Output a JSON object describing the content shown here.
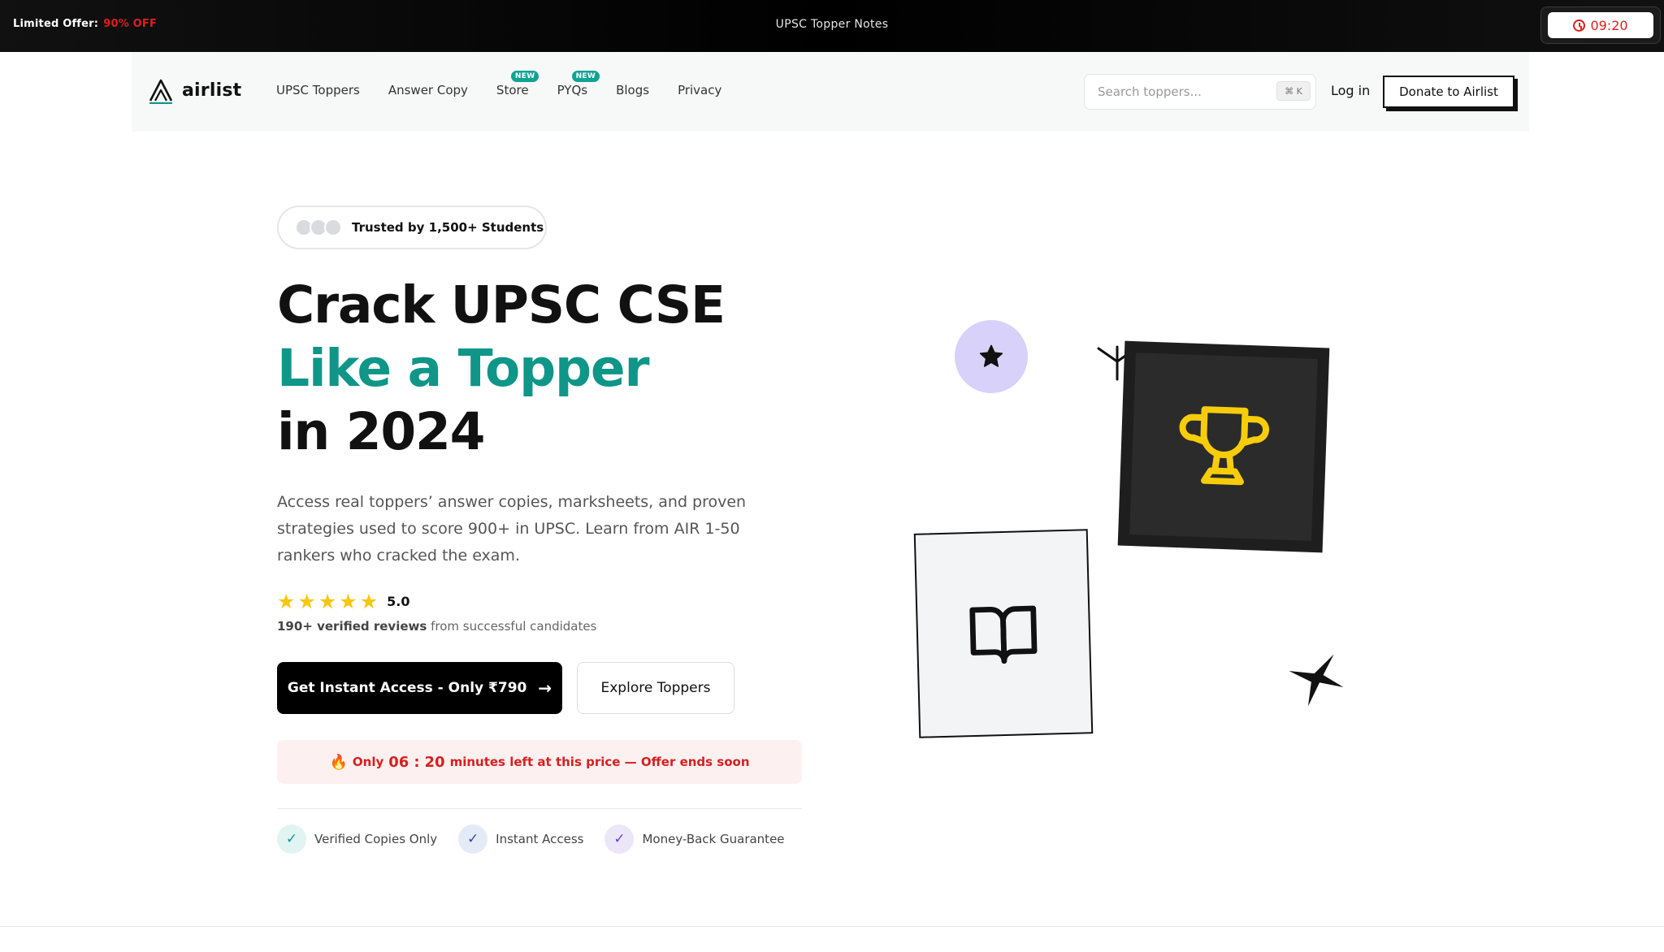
{
  "topbar": {
    "offer_label": "Limited Offer:",
    "offer_value": "90% OFF",
    "title": "UPSC Topper Notes",
    "timer": "09:20"
  },
  "nav": {
    "logo_text": "airlist",
    "links": [
      {
        "label": "UPSC Toppers",
        "badge": ""
      },
      {
        "label": "Answer Copy",
        "badge": ""
      },
      {
        "label": "Store",
        "badge": "NEW"
      },
      {
        "label": "PYQs",
        "badge": "NEW"
      },
      {
        "label": "Blogs",
        "badge": ""
      },
      {
        "label": "Privacy",
        "badge": ""
      }
    ],
    "search_placeholder": "Search toppers...",
    "search_shortcut": "⌘ K",
    "login": "Log in",
    "donate": "Donate to Airlist"
  },
  "hero": {
    "trust_text": "Trusted by 1,500+ Students",
    "headline_1": "Crack UPSC CSE",
    "headline_2": "Like a Topper",
    "headline_3": "in 2024",
    "description": "Access real toppers’ answer copies, marksheets, and proven strategies used to score 900+ in UPSC. Learn from AIR 1-50 rankers who cracked the exam.",
    "rating_value": "5.0",
    "stars": 5,
    "reviews_bold": "190+ verified reviews",
    "reviews_rest": "from successful candidates",
    "cta_primary": "Get Instant Access - Only ₹790",
    "cta_secondary": "Explore Toppers",
    "urgency_prefix": "Only",
    "urgency_minutes": "06",
    "urgency_sep": ":",
    "urgency_seconds": "20",
    "urgency_suffix": "minutes left at this price — Offer ends soon",
    "features": [
      "Verified Copies Only",
      "Instant Access",
      "Money-Back Guarantee"
    ]
  },
  "colors": {
    "accent_teal": "#0f9688",
    "offer_red": "#e11d1d",
    "star_yellow": "#f6c70f",
    "trophy_yellow": "#f7cc0a",
    "circle_lavender": "#d8d1fa"
  },
  "icons": [
    "clock-icon",
    "airlist-logo-icon",
    "star-icon",
    "trophy-icon",
    "open-book-icon",
    "sparkle-icon",
    "antenna-icon",
    "arrow-right-icon",
    "fire-icon",
    "check-icon"
  ]
}
